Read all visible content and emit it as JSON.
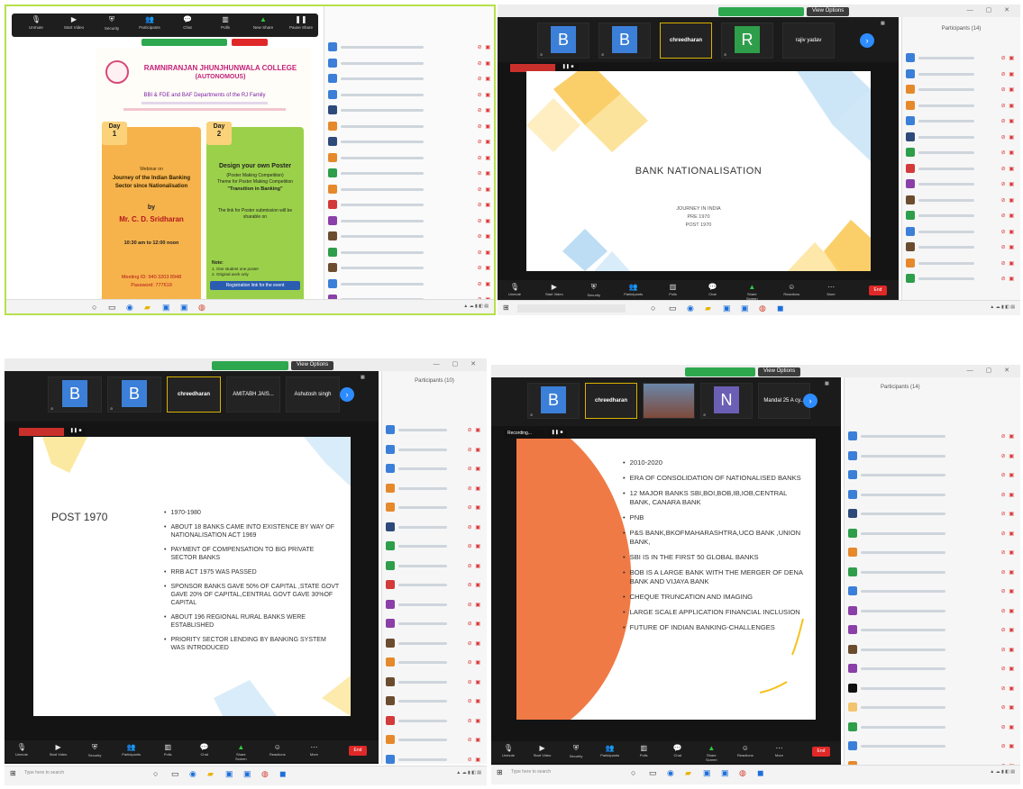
{
  "q1": {
    "zoom_toolbar": [
      {
        "label": "Unmute",
        "icon": "microphone-icon"
      },
      {
        "label": "Start Video",
        "icon": "video-icon"
      },
      {
        "label": "Security",
        "icon": "shield-icon"
      },
      {
        "label": "Participants",
        "icon": "participants-icon"
      },
      {
        "label": "Chat",
        "icon": "chat-icon"
      },
      {
        "label": "Polls",
        "icon": "polls-icon"
      },
      {
        "label": "New Share",
        "icon": "share-icon"
      },
      {
        "label": "Pause Share",
        "icon": "pause-icon"
      }
    ],
    "poster": {
      "college_name": "RAMNIRANJAN JHUNJHUNWALA COLLEGE",
      "college_sub": "(AUTONOMOUS)",
      "departments": "BBI & FDE and BAF Departments of the RJ Family",
      "day1": {
        "label": "Day",
        "num": "1",
        "title": "Webinar on",
        "topic": "Journey of the Indian Banking Sector since Nationalisation",
        "by": "by",
        "speaker": "Mr. C. D. Sridharan",
        "time": "10:30 am to 12:00 noon",
        "meeting": "Meeting ID: 940 3203 8948",
        "passcode": "Password: 777619"
      },
      "day2": {
        "label": "Day",
        "num": "2",
        "title": "Design your own Poster",
        "sub1": "(Poster Making Competition)",
        "sub2": "Theme for Poster Making Competition",
        "theme": "\"Transition in Banking\"",
        "note1": "The link for Poster submission will be sharable on",
        "note2": "Note:",
        "note3": "1. One student one poster",
        "note4": "2. Original work only",
        "reg": "Registration link for the event"
      }
    }
  },
  "q2": {
    "view_options": "View Options",
    "tiles": [
      {
        "avatar": "B",
        "name": "",
        "color": "#3b7fd8"
      },
      {
        "avatar": "B",
        "name": "",
        "color": "#3b7fd8"
      },
      {
        "avatar": "",
        "name": "chreedharan",
        "color": ""
      },
      {
        "avatar": "R",
        "name": "",
        "color": "#2e9e4a"
      },
      {
        "avatar": "",
        "name": "rajiv yadav",
        "color": ""
      }
    ],
    "slide": {
      "title": "BANK NATIONALISATION",
      "lines": [
        "JOURNEY IN INDIA",
        "PRE 1970",
        "POST 1970"
      ]
    },
    "end_label": "End"
  },
  "q3": {
    "view_options": "View Options",
    "participants_head": "Participants (10)",
    "tiles": [
      {
        "avatar": "B",
        "name": "",
        "color": "#3b7fd8"
      },
      {
        "avatar": "B",
        "name": "",
        "color": "#3b7fd8"
      },
      {
        "avatar": "",
        "name": "chreedharan",
        "color": ""
      },
      {
        "avatar": "",
        "name": "AMITABH JAIS...",
        "color": ""
      },
      {
        "avatar": "",
        "name": "Ashutosh singh",
        "color": ""
      }
    ],
    "slide": {
      "title": "POST 1970",
      "bullets": [
        "1970-1980",
        "ABOUT 18 BANKS CAME INTO EXISTENCE BY WAY OF NATIONALISATION ACT 1969",
        "PAYMENT OF COMPENSATION TO BIG PRIVATE SECTOR BANKS",
        "RRB ACT 1975 WAS PASSED",
        "SPONSOR BANKS GAVE 50% OF CAPITAL ,STATE GOVT GAVE 20% OF CAPITAL,CENTRAL GOVT GAVE 30%OF CAPITAL",
        "ABOUT 196 REGIONAL RURAL BANKS WERE ESTABLISHED",
        "PRIORITY SECTOR LENDING BY BANKING SYSTEM WAS INTRODUCED"
      ]
    },
    "end_label": "End",
    "taskbar_search": "Type here to search"
  },
  "q4": {
    "view_options": "View Options",
    "participants_head": "Participants (14)",
    "recording": "Recording...",
    "tiles": [
      {
        "avatar": "B",
        "name": "",
        "color": "#3b7fd8"
      },
      {
        "avatar": "",
        "name": "chreedharan",
        "color": ""
      },
      {
        "avatar": "",
        "name": "",
        "color": "photo"
      },
      {
        "avatar": "N",
        "name": "",
        "color": "#6b5fb5"
      },
      {
        "avatar": "",
        "name": "Mandal 25 A cy...",
        "color": ""
      }
    ],
    "slide": {
      "bullets": [
        "2010-2020",
        "ERA OF CONSOLIDATION OF NATIONALISED BANKS",
        "12 MAJOR BANKS SBI,BOI,BOB,IB,IOB,CENTRAL BANK, CANARA BANK",
        "PNB",
        "P&S BANK,BKOFMAHARASHTRA,UCO BANK ,UNION BANK,",
        "SBI IS IN THE FIRST 50 GLOBAL BANKS",
        "BOB IS A LARGE BANK WITH THE MERGER OF DENA BANK AND VIJAYA BANK",
        "CHEQUE TRUNCATION AND IMAGING",
        "LARGE SCALE APPLICATION FINANCIAL INCLUSION",
        "FUTURE OF INDIAN BANKING-CHALLENGES"
      ]
    },
    "end_label": "End",
    "taskbar_search": "Type here to search"
  },
  "toolbar_labels": [
    "Unmute",
    "Start Video",
    "Security",
    "Participants",
    "Polls",
    "Chat",
    "Share Screen",
    "Reactions",
    "More"
  ],
  "colors": {
    "zoom_blue": "#2d8cff",
    "record_red": "#c9302c",
    "green": "#2ea84f",
    "slide4_orange": "#f07a45"
  }
}
